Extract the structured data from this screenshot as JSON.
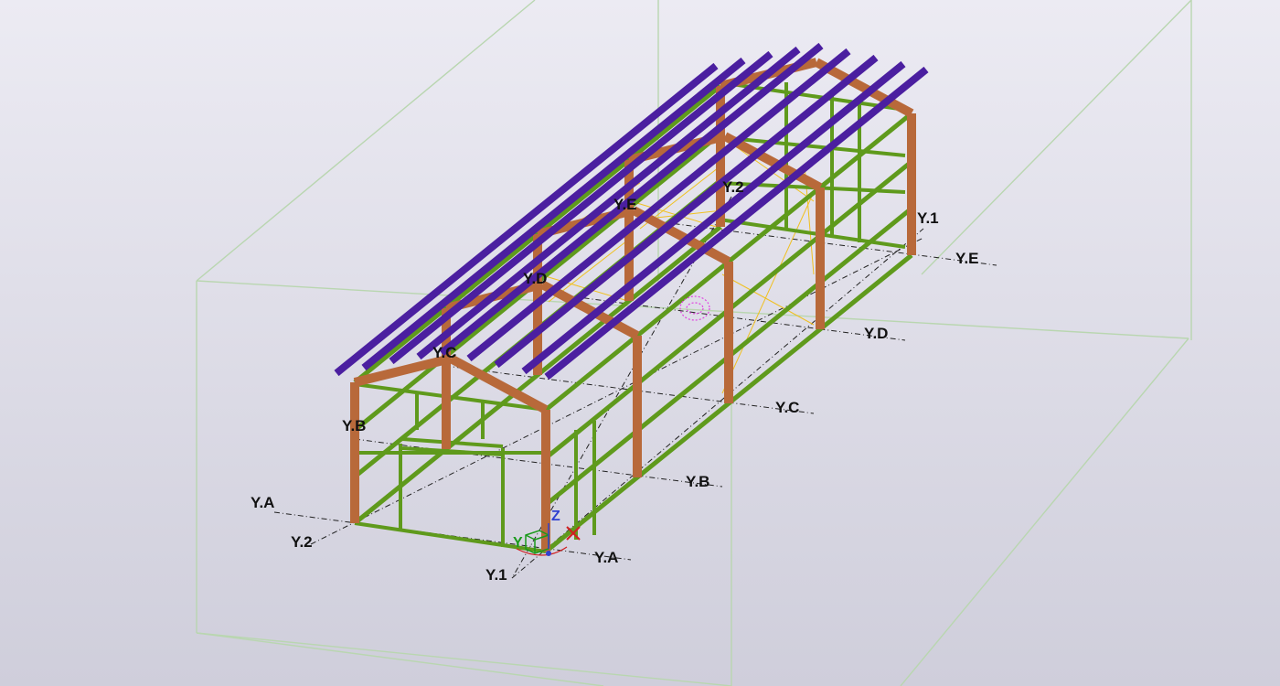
{
  "viewport": {
    "background_top": "#ecebf3",
    "background_bottom": "#cfcedb",
    "work_area_color": "#b9d6b0"
  },
  "colors": {
    "columns": "#b8693a",
    "rafters": "#b8693a",
    "purlins": "#4b1fa0",
    "girts": "#5f9a1c",
    "bracing": "#f0c020",
    "gridline": "#222222",
    "axis_x": "#d02020",
    "axis_y": "#1a9a1a",
    "axis_z": "#3040d0"
  },
  "grid_labels": {
    "ya_left": "Y.A",
    "y2_left": "Y.2",
    "y1_bottom": "Y.1",
    "ya_right": "Y.A",
    "yb_left": "Y.B",
    "yb_right": "Y.B",
    "yc_left": "Y.C",
    "yc_right": "Y.C",
    "yd_left": "Y.D",
    "yd_right": "Y.D",
    "ye_left": "Y.E",
    "ye_right": "Y.E",
    "y2_top": "Y.2",
    "y1_right": "Y.1"
  },
  "axis_indicator": {
    "x_label": "X",
    "y_label": "Y",
    "z_label": "Z",
    "x_icon": "axis-x-icon",
    "y_icon": "axis-y-icon",
    "z_icon": "axis-z-icon"
  },
  "view_rotation_center_icon": "rotation-center-icon"
}
